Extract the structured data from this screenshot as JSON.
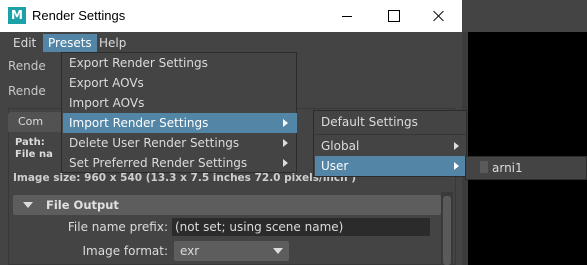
{
  "window": {
    "title": "Render Settings",
    "icon_letter": "M",
    "accent_color": "#5285a6",
    "icon_color": "#1ea0a8"
  },
  "menubar": {
    "edit": "Edit",
    "presets": "Presets",
    "help": "Help"
  },
  "background": {
    "render_using_label": "Rende",
    "render_layer_label": "Rende",
    "tab_common": "Com",
    "path_label": "Path:",
    "file_name_label": "File na",
    "image_size": "Image size: 960 x 540 (13.3 x 7.5 inches 72.0 pixels/inch )",
    "section_title": "File Output",
    "file_name_prefix_label": "File name prefix:",
    "file_name_prefix_value": "(not set; using scene name)",
    "image_format_label": "Image format:",
    "image_format_value": "exr"
  },
  "presets_menu": {
    "items": [
      {
        "label": "Export Render Settings",
        "submenu": false
      },
      {
        "label": "Export AOVs",
        "submenu": false
      },
      {
        "label": "Import AOVs",
        "submenu": false
      },
      {
        "label": "Import Render Settings",
        "submenu": true,
        "active": true
      },
      {
        "label": "Delete User Render Settings",
        "submenu": true
      },
      {
        "label": "Set Preferred Render Settings",
        "submenu": true
      }
    ]
  },
  "import_submenu": {
    "items": [
      {
        "label": "Default Settings",
        "submenu": false
      },
      {
        "label": "Global",
        "submenu": true
      },
      {
        "label": "User",
        "submenu": true,
        "active": true
      }
    ]
  },
  "user_submenu": {
    "items": [
      {
        "label": "arni1"
      }
    ]
  }
}
